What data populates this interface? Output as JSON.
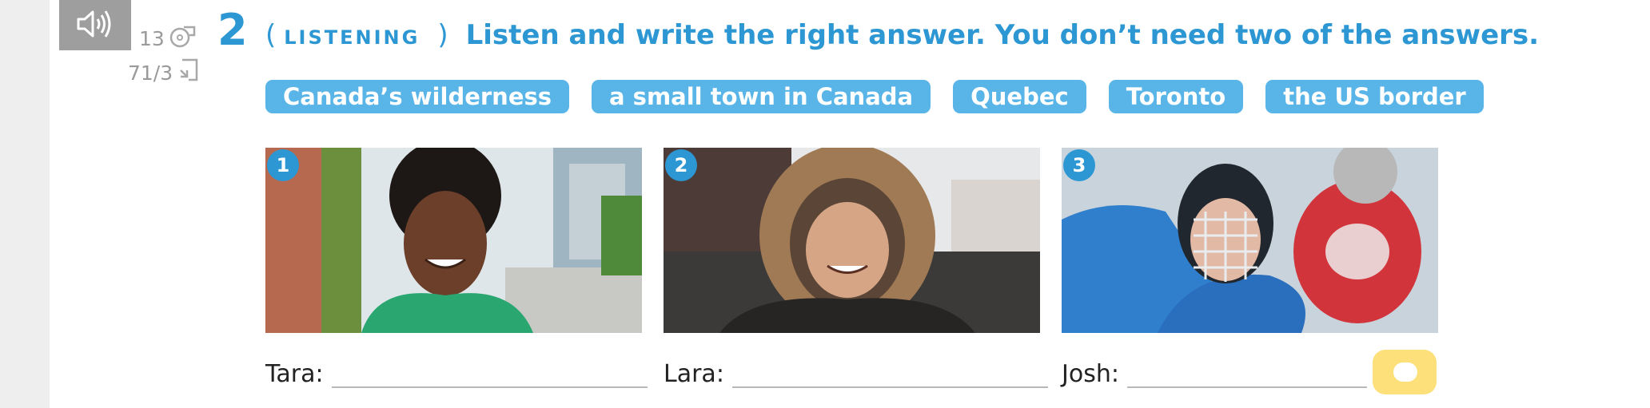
{
  "audio": {
    "icon": "speaker-icon"
  },
  "refs": {
    "cd_track": "13",
    "cd_icon": "cd-icon",
    "page_ref": "71/3",
    "page_icon": "page-icon"
  },
  "exercise": {
    "number": "2",
    "skill_open": "(",
    "skill": "LISTENING",
    "skill_close": ")",
    "instruction": "Listen and write the right answer. You don’t need two of the answers."
  },
  "answer_options": [
    "Canada’s wilderness",
    "a small town in Canada",
    "Quebec",
    "Toronto",
    "the US border"
  ],
  "photos": [
    {
      "number": "1",
      "subject": "smiling girl with curly hair on a city street"
    },
    {
      "number": "2",
      "subject": "smiling girl in a fur-hood parka in snow"
    },
    {
      "number": "3",
      "subject": "hockey player in helmet and blue jersey"
    }
  ],
  "answers": [
    {
      "name": "Tara:"
    },
    {
      "name": "Lara:"
    },
    {
      "name": "Josh:"
    }
  ],
  "colors": {
    "accent": "#2c97d3",
    "chip": "#59b5e8",
    "toggle": "#fde07a"
  }
}
